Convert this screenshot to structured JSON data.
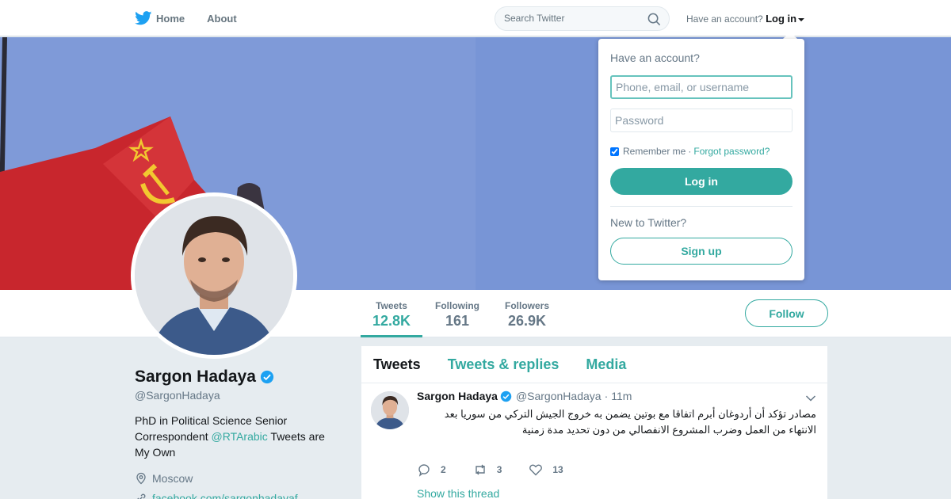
{
  "nav": {
    "home_label": "Home",
    "about_label": "About",
    "search_placeholder": "Search Twitter",
    "have_account_text": "Have an account?",
    "login_label": "Log in"
  },
  "profile": {
    "name": "Sargon Hadaya",
    "handle": "@SargonHadaya",
    "bio_prefix": "PhD in Political Science Senior Correspondent",
    "bio_mention": "@RTArabic",
    "bio_suffix": "Tweets are My Own",
    "location": "Moscow",
    "website": "facebook.com/sargonhadayaf"
  },
  "stats": [
    {
      "label": "Tweets",
      "value": "12.8K"
    },
    {
      "label": "Following",
      "value": "161"
    },
    {
      "label": "Followers",
      "value": "26.9K"
    }
  ],
  "follow_label": "Follow",
  "tabs": [
    "Tweets",
    "Tweets & replies",
    "Media"
  ],
  "tweet": {
    "name": "Sargon Hadaya",
    "handle": "@SargonHadaya",
    "separator": "·",
    "time": "11m",
    "text": "مصادر تؤكد أن أردوغان أبرم اتفاقا مع بوتين يضمن به خروج الجيش التركي من سوريا بعد الانتهاء من العمل وضرب المشروع الانفصالي من دون تحديد مدة زمنية",
    "replies": "2",
    "retweets": "3",
    "likes": "13",
    "thread_link": "Show this thread"
  },
  "login_dropdown": {
    "title": "Have an account?",
    "username_placeholder": "Phone, email, or username",
    "password_placeholder": "Password",
    "remember_label": "Remember me",
    "separator": "·",
    "forgot_label": "Forgot password?",
    "login_button": "Log in",
    "new_text": "New to Twitter?",
    "signup_button": "Sign up",
    "remember_checked": true
  },
  "colors": {
    "accent": "#33a9a0",
    "banner_blue": "#6f8fd3",
    "flag_red": "#c8262d",
    "emblem_yellow": "#f2c830"
  }
}
